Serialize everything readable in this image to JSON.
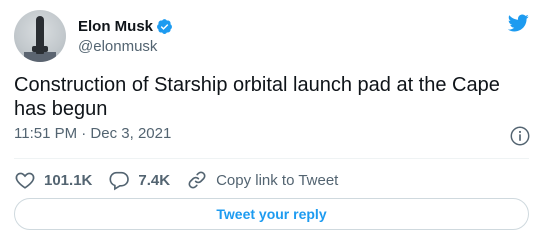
{
  "author": {
    "name": "Elon Musk",
    "handle": "@elonmusk"
  },
  "tweet": {
    "text": "Construction of Starship orbital launch pad at the Cape has begun",
    "timestamp": "11:51 PM · Dec 3, 2021"
  },
  "actions": {
    "likes": "101.1K",
    "replies": "7.4K",
    "copy_link": "Copy link to Tweet"
  },
  "reply_button": "Tweet your reply",
  "colors": {
    "accent": "#1d9bf0",
    "text": "#0f1419",
    "secondary": "#536471"
  },
  "icons": [
    "avatar",
    "verified-badge-icon",
    "twitter-bird-icon",
    "info-icon",
    "heart-icon",
    "reply-bubble-icon",
    "link-icon"
  ]
}
